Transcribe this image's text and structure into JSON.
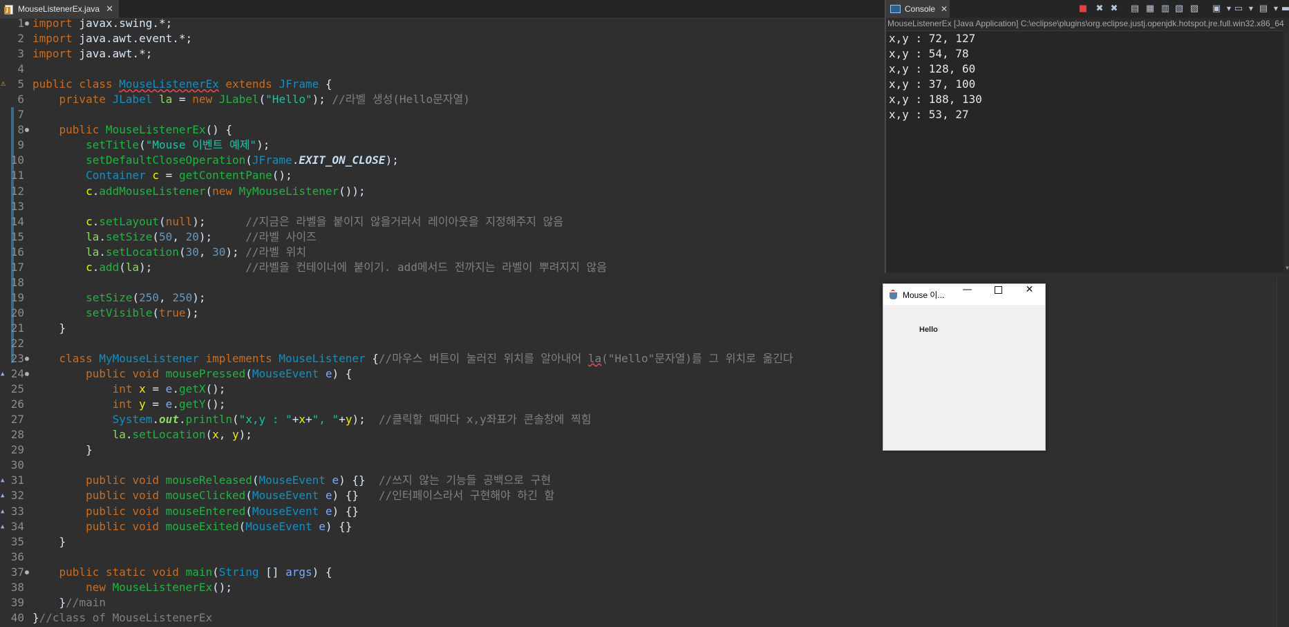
{
  "editor": {
    "tab_label": "MouseListenerEx.java",
    "lines": [
      {
        "num": "1",
        "fold": true,
        "segments": [
          [
            "k",
            "import"
          ],
          [
            "d",
            " javax.swing.*;"
          ]
        ]
      },
      {
        "num": "2",
        "segments": [
          [
            "k",
            "import"
          ],
          [
            "d",
            " java.awt.event.*;"
          ]
        ]
      },
      {
        "num": "3",
        "segments": [
          [
            "k",
            "import"
          ],
          [
            "d",
            " java.awt.*;"
          ]
        ]
      },
      {
        "num": "4",
        "segments": []
      },
      {
        "num": "5",
        "marker": "warn",
        "segments": [
          [
            "k",
            "public class "
          ],
          [
            "tsq",
            "MouseListenerEx"
          ],
          [
            "k",
            " extends "
          ],
          [
            "t",
            "JFrame"
          ],
          [
            "d",
            " {"
          ]
        ]
      },
      {
        "num": "6",
        "segments": [
          [
            "d",
            "    "
          ],
          [
            "k",
            "private "
          ],
          [
            "t",
            "JLabel "
          ],
          [
            "f",
            "la"
          ],
          [
            "d",
            " = "
          ],
          [
            "k",
            "new "
          ],
          [
            "m",
            "JLabel"
          ],
          [
            "d",
            "("
          ],
          [
            "s",
            "\"Hello\""
          ],
          [
            "d",
            "); "
          ],
          [
            "c",
            "//라벨 생성(Hello문자열)"
          ]
        ]
      },
      {
        "num": "7",
        "segments": []
      },
      {
        "num": "8",
        "fold": true,
        "segments": [
          [
            "d",
            "    "
          ],
          [
            "k",
            "public "
          ],
          [
            "m",
            "MouseListenerEx"
          ],
          [
            "d",
            "() {"
          ]
        ]
      },
      {
        "num": "9",
        "segments": [
          [
            "d",
            "        "
          ],
          [
            "m",
            "setTitle"
          ],
          [
            "d",
            "("
          ],
          [
            "s",
            "\"Mouse 이벤트 예제\""
          ],
          [
            "d",
            ");"
          ]
        ]
      },
      {
        "num": "10",
        "segments": [
          [
            "d",
            "        "
          ],
          [
            "m",
            "setDefaultCloseOperation"
          ],
          [
            "d",
            "("
          ],
          [
            "t",
            "JFrame"
          ],
          [
            "d",
            "."
          ],
          [
            "fi",
            "EXIT_ON_CLOSE"
          ],
          [
            "d",
            ");"
          ]
        ]
      },
      {
        "num": "11",
        "segments": [
          [
            "d",
            "        "
          ],
          [
            "t",
            "Container "
          ],
          [
            "v",
            "c"
          ],
          [
            "d",
            " = "
          ],
          [
            "m",
            "getContentPane"
          ],
          [
            "d",
            "();"
          ]
        ]
      },
      {
        "num": "12",
        "segments": [
          [
            "d",
            "        "
          ],
          [
            "v",
            "c"
          ],
          [
            "d",
            "."
          ],
          [
            "m",
            "addMouseListener"
          ],
          [
            "d",
            "("
          ],
          [
            "k",
            "new "
          ],
          [
            "m",
            "MyMouseListener"
          ],
          [
            "d",
            "());"
          ]
        ]
      },
      {
        "num": "13",
        "segments": []
      },
      {
        "num": "14",
        "segments": [
          [
            "d",
            "        "
          ],
          [
            "v",
            "c"
          ],
          [
            "d",
            "."
          ],
          [
            "m",
            "setLayout"
          ],
          [
            "d",
            "("
          ],
          [
            "k",
            "null"
          ],
          [
            "d",
            ");      "
          ],
          [
            "c",
            "//지금은 라벨을 붙이지 않을거라서 레이아웃을 지정해주지 않음"
          ]
        ]
      },
      {
        "num": "15",
        "segments": [
          [
            "d",
            "        "
          ],
          [
            "f",
            "la"
          ],
          [
            "d",
            "."
          ],
          [
            "m",
            "setSize"
          ],
          [
            "d",
            "("
          ],
          [
            "n",
            "50"
          ],
          [
            "d",
            ", "
          ],
          [
            "n",
            "20"
          ],
          [
            "d",
            ");     "
          ],
          [
            "c",
            "//라벨 사이즈"
          ]
        ]
      },
      {
        "num": "16",
        "segments": [
          [
            "d",
            "        "
          ],
          [
            "f",
            "la"
          ],
          [
            "d",
            "."
          ],
          [
            "m",
            "setLocation"
          ],
          [
            "d",
            "("
          ],
          [
            "n",
            "30"
          ],
          [
            "d",
            ", "
          ],
          [
            "n",
            "30"
          ],
          [
            "d",
            "); "
          ],
          [
            "c",
            "//라벨 위치"
          ]
        ]
      },
      {
        "num": "17",
        "segments": [
          [
            "d",
            "        "
          ],
          [
            "v",
            "c"
          ],
          [
            "d",
            "."
          ],
          [
            "m",
            "add"
          ],
          [
            "d",
            "("
          ],
          [
            "f",
            "la"
          ],
          [
            "d",
            ");              "
          ],
          [
            "c",
            "//라벨을 컨테이너에 붙이기. add메서드 전까지는 라벨이 뿌려지지 않음"
          ]
        ]
      },
      {
        "num": "18",
        "segments": []
      },
      {
        "num": "19",
        "segments": [
          [
            "d",
            "        "
          ],
          [
            "m",
            "setSize"
          ],
          [
            "d",
            "("
          ],
          [
            "n",
            "250"
          ],
          [
            "d",
            ", "
          ],
          [
            "n",
            "250"
          ],
          [
            "d",
            ");"
          ]
        ]
      },
      {
        "num": "20",
        "segments": [
          [
            "d",
            "        "
          ],
          [
            "m",
            "setVisible"
          ],
          [
            "d",
            "("
          ],
          [
            "k",
            "true"
          ],
          [
            "d",
            ");"
          ]
        ]
      },
      {
        "num": "21",
        "segments": [
          [
            "d",
            "    }"
          ]
        ]
      },
      {
        "num": "22",
        "segments": []
      },
      {
        "num": "23",
        "fold": true,
        "segments": [
          [
            "d",
            "    "
          ],
          [
            "k",
            "class "
          ],
          [
            "t",
            "MyMouseListener "
          ],
          [
            "k",
            "implements "
          ],
          [
            "t",
            "MouseListener"
          ],
          [
            "d",
            " {"
          ],
          [
            "c",
            "//마우스 버튼이 눌러진 위치를 알아내어 "
          ],
          [
            "csq",
            "la"
          ],
          [
            "c",
            "(\"Hello\"문자열)를 그 위치로 옮긴다"
          ]
        ]
      },
      {
        "num": "24",
        "fold": true,
        "marker": "override",
        "segments": [
          [
            "d",
            "        "
          ],
          [
            "k",
            "public void "
          ],
          [
            "m",
            "mousePressed"
          ],
          [
            "d",
            "("
          ],
          [
            "t",
            "MouseEvent "
          ],
          [
            "p",
            "e"
          ],
          [
            "d",
            ") {"
          ]
        ]
      },
      {
        "num": "25",
        "segments": [
          [
            "d",
            "            "
          ],
          [
            "k",
            "int "
          ],
          [
            "v",
            "x"
          ],
          [
            "d",
            " = "
          ],
          [
            "p",
            "e"
          ],
          [
            "d",
            "."
          ],
          [
            "m",
            "getX"
          ],
          [
            "d",
            "();"
          ]
        ]
      },
      {
        "num": "26",
        "segments": [
          [
            "d",
            "            "
          ],
          [
            "k",
            "int "
          ],
          [
            "v",
            "y"
          ],
          [
            "d",
            " = "
          ],
          [
            "p",
            "e"
          ],
          [
            "d",
            "."
          ],
          [
            "m",
            "getY"
          ],
          [
            "d",
            "();"
          ]
        ]
      },
      {
        "num": "27",
        "segments": [
          [
            "d",
            "            "
          ],
          [
            "t",
            "System"
          ],
          [
            "d",
            "."
          ],
          [
            "st",
            "out"
          ],
          [
            "d",
            "."
          ],
          [
            "m",
            "println"
          ],
          [
            "d",
            "("
          ],
          [
            "s",
            "\"x,y : \""
          ],
          [
            "d",
            "+"
          ],
          [
            "v",
            "x"
          ],
          [
            "d",
            "+"
          ],
          [
            "s",
            "\", \""
          ],
          [
            "d",
            "+"
          ],
          [
            "v",
            "y"
          ],
          [
            "d",
            ");  "
          ],
          [
            "c",
            "//클릭할 때마다 x,y좌표가 콘솔창에 찍힘"
          ]
        ]
      },
      {
        "num": "28",
        "segments": [
          [
            "d",
            "            "
          ],
          [
            "f",
            "la"
          ],
          [
            "d",
            "."
          ],
          [
            "m",
            "setLocation"
          ],
          [
            "d",
            "("
          ],
          [
            "v",
            "x"
          ],
          [
            "d",
            ", "
          ],
          [
            "v",
            "y"
          ],
          [
            "d",
            ");"
          ]
        ]
      },
      {
        "num": "29",
        "segments": [
          [
            "d",
            "        }"
          ]
        ]
      },
      {
        "num": "30",
        "segments": []
      },
      {
        "num": "31",
        "marker": "override",
        "segments": [
          [
            "d",
            "        "
          ],
          [
            "k",
            "public void "
          ],
          [
            "m",
            "mouseReleased"
          ],
          [
            "d",
            "("
          ],
          [
            "t",
            "MouseEvent "
          ],
          [
            "p",
            "e"
          ],
          [
            "d",
            ") {}  "
          ],
          [
            "c",
            "//쓰지 않는 기능들 공백으로 구현"
          ]
        ]
      },
      {
        "num": "32",
        "marker": "override",
        "segments": [
          [
            "d",
            "        "
          ],
          [
            "k",
            "public void "
          ],
          [
            "m",
            "mouseClicked"
          ],
          [
            "d",
            "("
          ],
          [
            "t",
            "MouseEvent "
          ],
          [
            "p",
            "e"
          ],
          [
            "d",
            ") {}   "
          ],
          [
            "c",
            "//인터페이스라서 구현해야 하긴 함"
          ]
        ]
      },
      {
        "num": "33",
        "marker": "override",
        "segments": [
          [
            "d",
            "        "
          ],
          [
            "k",
            "public void "
          ],
          [
            "m",
            "mouseEntered"
          ],
          [
            "d",
            "("
          ],
          [
            "t",
            "MouseEvent "
          ],
          [
            "p",
            "e"
          ],
          [
            "d",
            ") {}"
          ]
        ]
      },
      {
        "num": "34",
        "marker": "override",
        "segments": [
          [
            "d",
            "        "
          ],
          [
            "k",
            "public void "
          ],
          [
            "m",
            "mouseExited"
          ],
          [
            "d",
            "("
          ],
          [
            "t",
            "MouseEvent "
          ],
          [
            "p",
            "e"
          ],
          [
            "d",
            ") {}"
          ]
        ]
      },
      {
        "num": "35",
        "segments": [
          [
            "d",
            "    }"
          ]
        ]
      },
      {
        "num": "36",
        "segments": []
      },
      {
        "num": "37",
        "fold": true,
        "segments": [
          [
            "d",
            "    "
          ],
          [
            "k",
            "public static void "
          ],
          [
            "m",
            "main"
          ],
          [
            "d",
            "("
          ],
          [
            "t",
            "String "
          ],
          [
            "d",
            "[] "
          ],
          [
            "p",
            "args"
          ],
          [
            "d",
            ") {"
          ]
        ]
      },
      {
        "num": "38",
        "segments": [
          [
            "d",
            "        "
          ],
          [
            "k",
            "new "
          ],
          [
            "m",
            "MouseListenerEx"
          ],
          [
            "d",
            "();"
          ]
        ]
      },
      {
        "num": "39",
        "segments": [
          [
            "d",
            "    }"
          ],
          [
            "c",
            "//main"
          ]
        ]
      },
      {
        "num": "40",
        "segments": [
          [
            "d",
            "}"
          ],
          [
            "c",
            "//class of MouseListenerEx"
          ]
        ]
      }
    ]
  },
  "console": {
    "tab_label": "Console",
    "description": "MouseListenerEx [Java Application] C:\\eclipse\\plugins\\org.eclipse.justj.openjdk.hotspot.jre.full.win32.x86_64",
    "output": [
      "x,y : 72, 127",
      "x,y : 54, 78",
      "x,y : 128, 60",
      "x,y : 37, 100",
      "x,y : 188, 130",
      "x,y : 53, 27"
    ],
    "toolbar_icons": [
      "terminate-icon",
      "remove-launch-icon",
      "remove-all-icon",
      "scroll-lock-icon",
      "word-wrap-icon",
      "pin-icon",
      "show-on-output-icon",
      "display-console-icon",
      "open-console-icon",
      "minimize-icon"
    ]
  },
  "app_window": {
    "title": "Mouse 이...",
    "label": "Hello",
    "minimize_glyph": "—",
    "close_glyph": "✕"
  }
}
